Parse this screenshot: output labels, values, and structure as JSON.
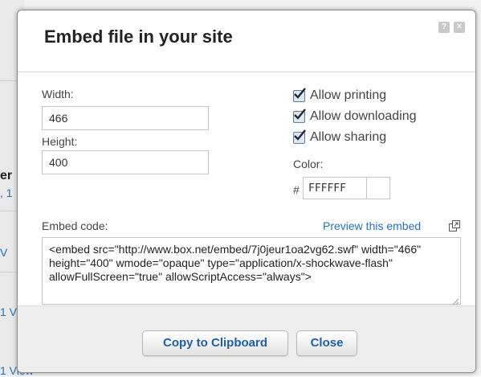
{
  "dialog": {
    "title": "Embed file in your site",
    "help_label": "?",
    "close_label": "✕"
  },
  "form": {
    "width_label": "Width:",
    "width_value": "466",
    "height_label": "Height:",
    "height_value": "400",
    "options": [
      {
        "label": "Allow printing",
        "checked": true
      },
      {
        "label": "Allow downloading",
        "checked": true
      },
      {
        "label": "Allow sharing",
        "checked": true
      }
    ],
    "color_label": "Color:",
    "color_prefix": "#",
    "color_value": "FFFFFF",
    "color_swatch": "#ffffff",
    "embed_label": "Embed code:",
    "preview_link": "Preview this embed",
    "embed_code": "<embed src=\"http://www.box.net/embed/7j0jeur1oa2vg62.swf\" width=\"466\" height=\"400\" wmode=\"opaque\" type=\"application/x-shockwave-flash\" allowFullScreen=\"true\" allowScriptAccess=\"always\">"
  },
  "footer": {
    "copy_label": "Copy to Clipboard",
    "close_label": "Close"
  },
  "background": {
    "fragments": [
      "er",
      ", 1",
      "V",
      "1 V",
      "1 View"
    ]
  },
  "colors": {
    "link": "#2a6fb8",
    "button_text": "#1f5fa8"
  }
}
